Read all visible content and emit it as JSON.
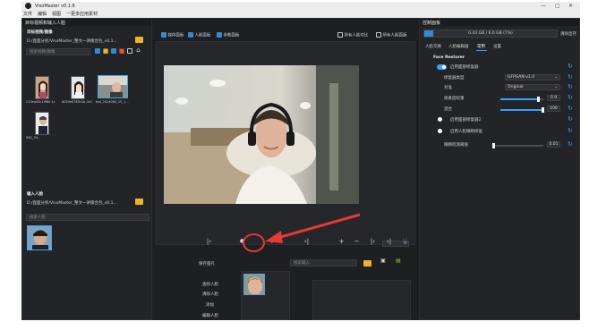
{
  "window": {
    "title": "VisoMaster v0.1.6",
    "controls": [
      "—",
      "▢",
      "✕"
    ]
  },
  "menu": [
    "文件",
    "编辑",
    "视图",
    "一更多应用素材"
  ],
  "left": {
    "header": "目标视频和输入人脸",
    "target_label": "目标视频/图像",
    "target_path": "D:/直面分析/VisoMaster_整文一讲版合包_v0.1...",
    "search_placeholder": "搜索视频/图像",
    "thumbs": [
      {
        "caption": "213ea43c1f98e 1b80a0c48c48 9b0c2ee1e1c2..."
      },
      {
        "caption": "6020e0783c1b 2e1cb5c2e3e..."
      },
      {
        "caption": "tod_2024060_15_1..."
      },
      {
        "caption": "IMG_30..."
      }
    ],
    "input_label": "输入人脸",
    "input_path": "D:/直面分析/VisoMaster_整文一讲版合包_v0.1...",
    "input_search_placeholder": "搜索人脸"
  },
  "center": {
    "checks": [
      {
        "label": "媒体面板",
        "checked": true
      },
      {
        "label": "人脸面板",
        "checked": true
      },
      {
        "label": "参数面板",
        "checked": true
      }
    ],
    "right_checks": [
      {
        "label": "所有人脸对比",
        "checked": false
      },
      {
        "label": "所有人脸面版",
        "checked": false
      }
    ],
    "frame_number": "0",
    "controls": {
      "prev": "|‹",
      "stop": "●",
      "play": "▶",
      "next": "›|",
      "add": "+",
      "remove": "−",
      "mark_prev": "|‹",
      "mark_next": "›|",
      "fullscreen": "⛶"
    },
    "saved_faces_label": "保存面孔",
    "face_search_placeholder": "搜索输入",
    "face_actions": [
      "查找人脸",
      "清除人脸",
      "添加",
      "编辑人脸"
    ]
  },
  "right": {
    "header": "控制面板",
    "vram_text": "0.43 GB / 6.0 GB (7%)",
    "vram_fraction": 0.07,
    "clear_button": "清除显存",
    "tabs": [
      "人脸交换",
      "人脸编辑器",
      "常用",
      "设置"
    ],
    "active_tab": 2,
    "section": "Face Restorer",
    "enable_restorer": "启用面部修复器",
    "restorer_type_label": "修复器类型",
    "restorer_type_value": "GFPGAN-v1.4",
    "align_label": "对准",
    "align_value": "Original",
    "fidelity_label": "保真度权重",
    "fidelity_value": "0.9",
    "fidelity_fraction": 0.9,
    "blend_label": "混合",
    "blend_value": "100",
    "blend_fraction": 1.0,
    "enable_restorer2": "启用面部修复器2",
    "enable_eye_fix": "启用人脸眼睛修复",
    "eye_threshold_label": "眼睛检测阈值",
    "eye_threshold_value": "0.01",
    "eye_threshold_fraction": 0.01
  },
  "colors": {
    "accent": "#3aa0ff",
    "annotation": "#e53935",
    "folder": "#f0b429"
  }
}
